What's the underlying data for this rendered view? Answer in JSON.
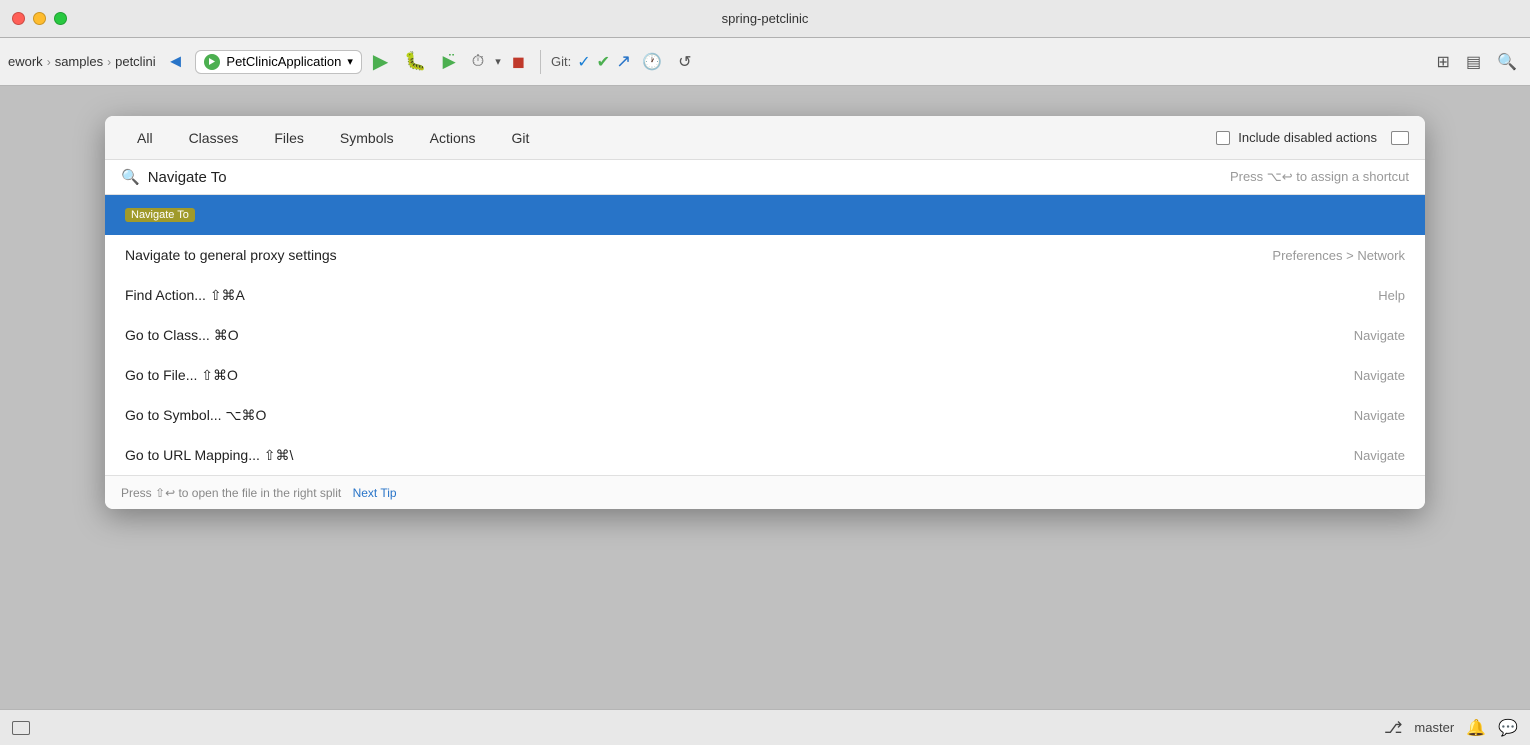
{
  "window": {
    "title": "spring-petclinic"
  },
  "toolbar": {
    "breadcrumb": [
      "ework",
      "samples",
      "petclini"
    ],
    "run_config": "PetClinicApplication",
    "git_label": "Git:"
  },
  "popup": {
    "tabs": [
      "All",
      "Classes",
      "Files",
      "Symbols",
      "Actions",
      "Git"
    ],
    "active_tab": "Actions",
    "include_disabled_label": "Include disabled actions",
    "search_value": "Navigate To",
    "shortcut_hint": "Press ⌥↩ to assign a shortcut",
    "results": [
      {
        "name": "Navigate To",
        "badge": "Navigate To",
        "shortcut": "",
        "category": "",
        "selected": true
      },
      {
        "name": "Navigate to general proxy settings",
        "badge": "",
        "shortcut": "",
        "category": "Preferences > Network",
        "selected": false
      },
      {
        "name": "Find Action...  ⇧⌘A",
        "badge": "",
        "shortcut": "",
        "category": "Help",
        "selected": false
      },
      {
        "name": "Go to Class...  ⌘O",
        "badge": "",
        "shortcut": "",
        "category": "Navigate",
        "selected": false
      },
      {
        "name": "Go to File...  ⇧⌘O",
        "badge": "",
        "shortcut": "",
        "category": "Navigate",
        "selected": false
      },
      {
        "name": "Go to Symbol...  ⌥⌘O",
        "badge": "",
        "shortcut": "",
        "category": "Navigate",
        "selected": false
      },
      {
        "name": "Go to URL Mapping...  ⇧⌘\\",
        "badge": "",
        "shortcut": "",
        "category": "Navigate",
        "selected": false
      }
    ],
    "footer_tip": "Press ⇧↩ to open the file in the right split",
    "next_tip": "Next Tip"
  },
  "status_bar": {
    "branch": "master"
  }
}
